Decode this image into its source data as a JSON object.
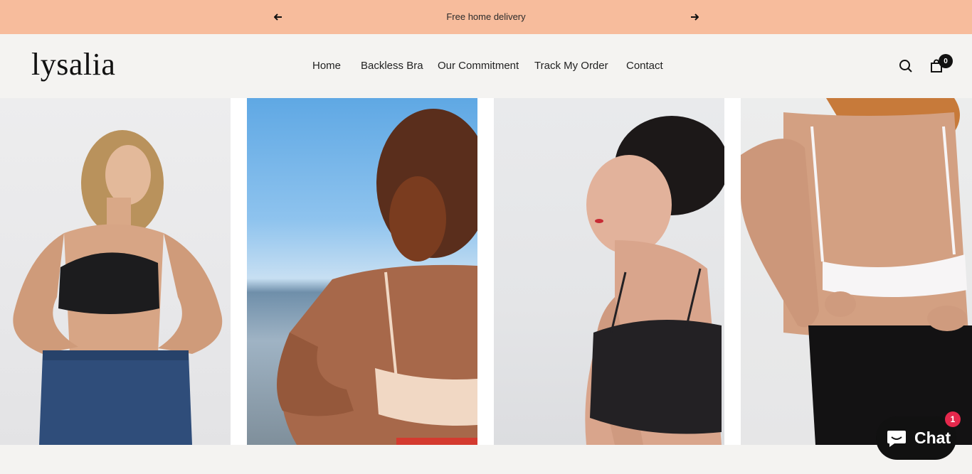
{
  "announcement": {
    "message": "Free home delivery",
    "prev_icon": "arrow-left-icon",
    "next_icon": "arrow-right-icon"
  },
  "header": {
    "logo": "lysalia",
    "nav": [
      {
        "label": "Home"
      },
      {
        "label": "Backless Bra"
      },
      {
        "label": "Our Commitment"
      },
      {
        "label": "Track My Order"
      },
      {
        "label": "Contact"
      }
    ],
    "search_icon": "search-icon",
    "cart_icon": "shopping-bag-icon",
    "cart_count": "0"
  },
  "gallery": {
    "photos": [
      {
        "subject": "model-front-black-bra"
      },
      {
        "subject": "model-back-beige-bra-beach"
      },
      {
        "subject": "model-side-black-bra"
      },
      {
        "subject": "model-back-white-bra"
      }
    ]
  },
  "chat_widget": {
    "label": "Chat",
    "badge": "1",
    "icon": "chat-bubble-icon"
  },
  "colors": {
    "announcement_bg": "#f7bc9c",
    "header_bg": "#f4f3f1",
    "chat_bg": "#111111",
    "badge_bg": "#e5284c"
  }
}
